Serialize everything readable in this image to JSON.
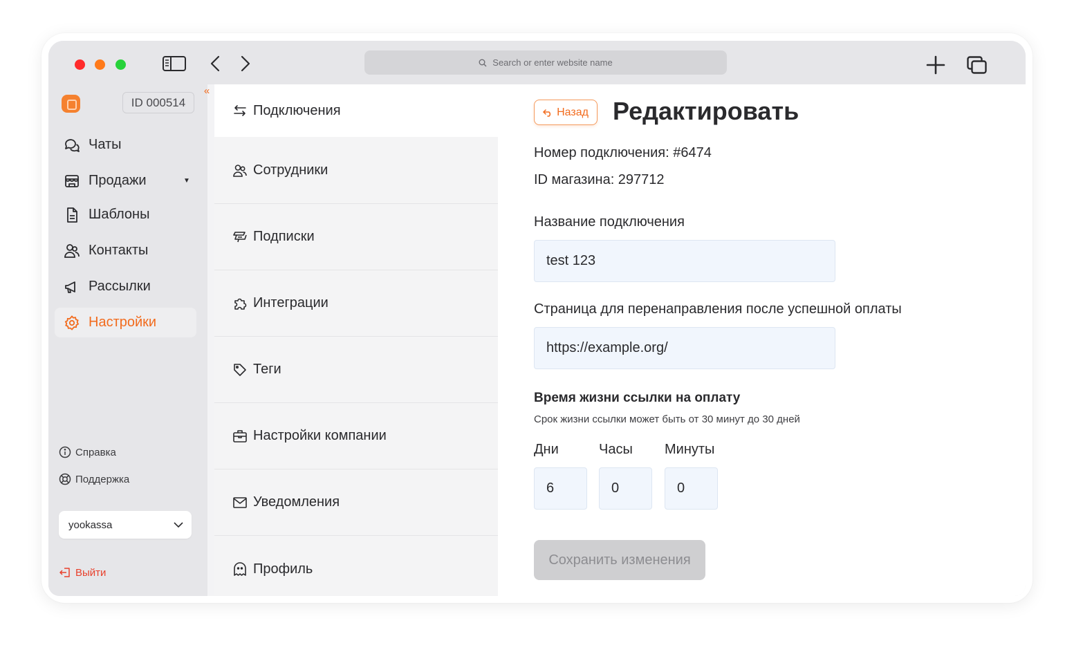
{
  "browser": {
    "address_placeholder": "Search or enter website name"
  },
  "sidebar": {
    "account_id": "ID 000514",
    "items": [
      {
        "label": "Чаты"
      },
      {
        "label": "Продажи"
      },
      {
        "label": "Шаблоны"
      },
      {
        "label": "Контакты"
      },
      {
        "label": "Рассылки"
      },
      {
        "label": "Настройки"
      }
    ],
    "help_label": "Справка",
    "support_label": "Поддержка",
    "shop_select_value": "yookassa",
    "logout_label": "Выйти"
  },
  "settings_menu": {
    "items": [
      {
        "label": "Подключения"
      },
      {
        "label": "Сотрудники"
      },
      {
        "label": "Подписки"
      },
      {
        "label": "Интеграции"
      },
      {
        "label": "Теги"
      },
      {
        "label": "Настройки компании"
      },
      {
        "label": "Уведомления"
      },
      {
        "label": "Профиль"
      }
    ]
  },
  "editor": {
    "back_label": "Назад",
    "title": "Редактировать",
    "connection_number": "Номер подключения: #6474",
    "shop_id": "ID магазина: 297712",
    "name_label": "Название подключения",
    "name_value": "test 123",
    "redirect_label": "Страница для перенаправления после успешной оплаты",
    "redirect_value": "https://example.org/",
    "lifetime_title": "Время жизни ссылки на оплату",
    "lifetime_hint": "Срок жизни ссылки может быть от 30 минут до 30 дней",
    "days_label": "Дни",
    "days_value": "6",
    "hours_label": "Часы",
    "hours_value": "0",
    "minutes_label": "Минуты",
    "minutes_value": "0",
    "save_label": "Сохранить изменения"
  },
  "colors": {
    "accent": "#f26b1d",
    "logout": "#e8402c",
    "input_bg": "#f1f6fd"
  }
}
